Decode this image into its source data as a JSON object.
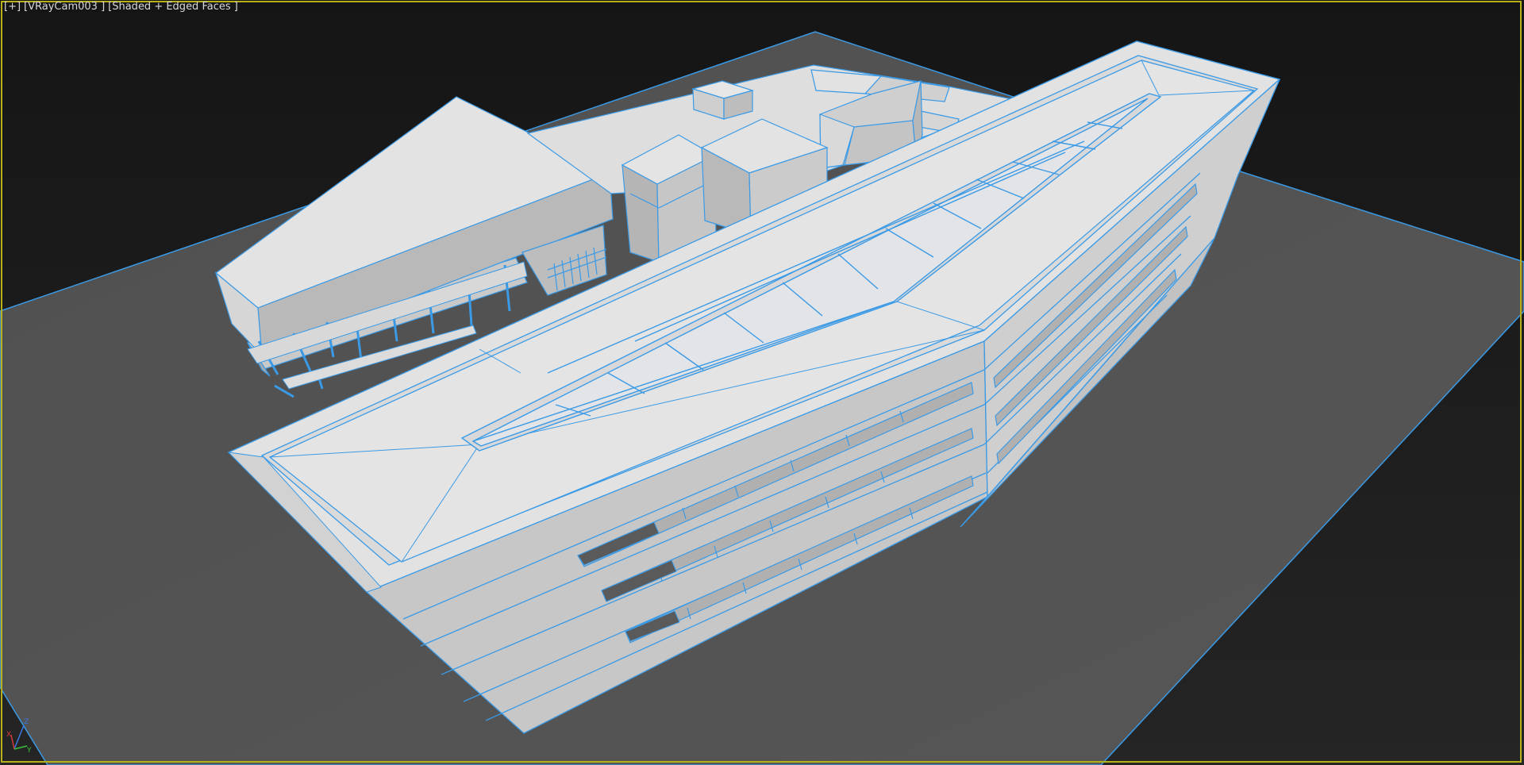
{
  "viewport": {
    "menu_plus": "[+]",
    "camera_label": "[VRayCam003 ]",
    "shading_label": "[Shaded + Edged Faces ]",
    "border_color": "#b8b01a",
    "edge_color": "#3a9ae6",
    "background_color": "#1b1b1b",
    "ground_color": "#535353"
  },
  "axis_gizmo": {
    "x_label": "X",
    "y_label": "Y",
    "z_label": "Z",
    "x_color": "#d03a3a",
    "y_color": "#3ac03a",
    "z_color": "#3a7ae6"
  },
  "scene": {
    "object": "building-model",
    "elements": [
      "ground-plane",
      "main-building",
      "skylight",
      "tower-blocks",
      "rear-wing",
      "columns"
    ]
  }
}
